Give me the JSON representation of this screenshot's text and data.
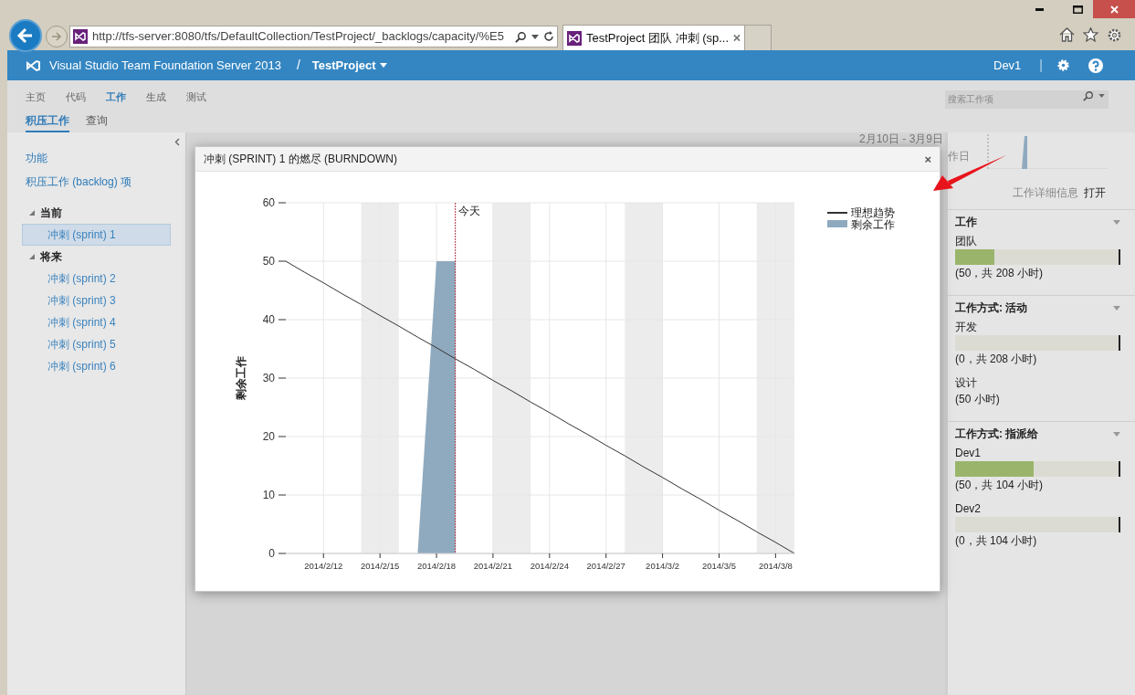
{
  "browser": {
    "url": "http://tfs-server:8080/tfs/DefaultCollection/TestProject/_backlogs/capacity/%E5",
    "tabs": [
      {
        "title": "TestProject 团队 冲刺 (sp...",
        "selected": true
      }
    ]
  },
  "header": {
    "product": "Visual Studio Team Foundation Server 2013",
    "separator": "/",
    "project": "TestProject",
    "user": "Dev1",
    "divider": "|"
  },
  "nav": {
    "hubs": [
      {
        "label": "主页",
        "selected": false
      },
      {
        "label": "代码",
        "selected": false
      },
      {
        "label": "工作",
        "selected": true
      },
      {
        "label": "生成",
        "selected": false
      },
      {
        "label": "测试",
        "selected": false
      }
    ],
    "tabs": [
      {
        "label": "积压工作",
        "selected": true
      },
      {
        "label": "查询",
        "selected": false
      }
    ],
    "search": {
      "placeholder": "搜索工作项"
    }
  },
  "sidebar": {
    "links": [
      "功能",
      "积压工作 (backlog) 项"
    ],
    "tree": [
      {
        "label": "当前",
        "expanded": true,
        "children": [
          {
            "label": "冲刺 (sprint) 1",
            "selected": true
          }
        ]
      },
      {
        "label": "将来",
        "expanded": true,
        "children": [
          {
            "label": "冲刺 (sprint) 2",
            "selected": false
          },
          {
            "label": "冲刺 (sprint) 3",
            "selected": false
          },
          {
            "label": "冲刺 (sprint) 4",
            "selected": false
          },
          {
            "label": "冲刺 (sprint) 5",
            "selected": false
          },
          {
            "label": "冲刺 (sprint) 6",
            "selected": false
          }
        ]
      }
    ]
  },
  "dialog": {
    "title": "冲刺 (SPRINT) 1 的燃尽 (BURNDOWN)",
    "close": "×",
    "chart_data": {
      "type": "line",
      "grid": true,
      "ylabel": "剩余工作",
      "ylim": [
        0,
        60
      ],
      "yticks": [
        0,
        10,
        20,
        30,
        40,
        50,
        60
      ],
      "categories": [
        null,
        null,
        "2014/2/12",
        null,
        null,
        "2014/2/15",
        null,
        null,
        "2014/2/18",
        null,
        null,
        "2014/2/21",
        null,
        null,
        "2014/2/24",
        null,
        null,
        "2014/2/27",
        null,
        null,
        "2014/3/2",
        null,
        null,
        "2014/3/5",
        null,
        null,
        "2014/3/8",
        null
      ],
      "series": [
        {
          "name": "理想趋势",
          "color": "#333333",
          "values": [
            50,
            48.1,
            46.3,
            44.4,
            42.6,
            40.7,
            38.9,
            37,
            35.2,
            33.3,
            31.5,
            29.6,
            27.8,
            25.9,
            24.1,
            22.2,
            20.4,
            18.5,
            16.7,
            14.8,
            13,
            11.1,
            9.3,
            7.4,
            5.6,
            3.7,
            1.9,
            0
          ]
        },
        {
          "name": "剩余工作",
          "type": "area",
          "color": "#8faabf",
          "values": [
            null,
            null,
            null,
            null,
            null,
            null,
            null,
            0,
            50,
            50,
            null,
            null,
            null,
            null,
            null,
            null,
            null,
            null,
            null,
            null,
            null,
            null,
            null,
            null,
            null,
            null,
            null,
            null
          ]
        }
      ],
      "legend": "right"
    },
    "today_label": "今天"
  },
  "right_panel": {
    "range": "2月10日 - 3月9日",
    "range_sub": "作日",
    "details_label": "工作详细信息",
    "details_action": "打开",
    "sections": [
      {
        "title": "工作",
        "expanded": true,
        "items": [
          {
            "kind": "bar",
            "name": "团队",
            "level": 0.24,
            "reading": "(50，共 208 小时)"
          }
        ]
      },
      {
        "title": "工作方式: 活动",
        "expanded": true,
        "items": [
          {
            "kind": "bar",
            "name": "开发",
            "reading": "(0，共 208 小时)"
          },
          {
            "kind": "plain",
            "name": "设计",
            "reading": "(50 小时)"
          }
        ]
      },
      {
        "title": "工作方式: 指派给",
        "expanded": true,
        "items": [
          {
            "kind": "bar",
            "name": "Dev1",
            "level": 0.48,
            "reading": "(50，共 104 小时)"
          },
          {
            "kind": "bar",
            "name": "Dev2",
            "reading": "(0，共 104 小时)"
          }
        ]
      }
    ]
  }
}
